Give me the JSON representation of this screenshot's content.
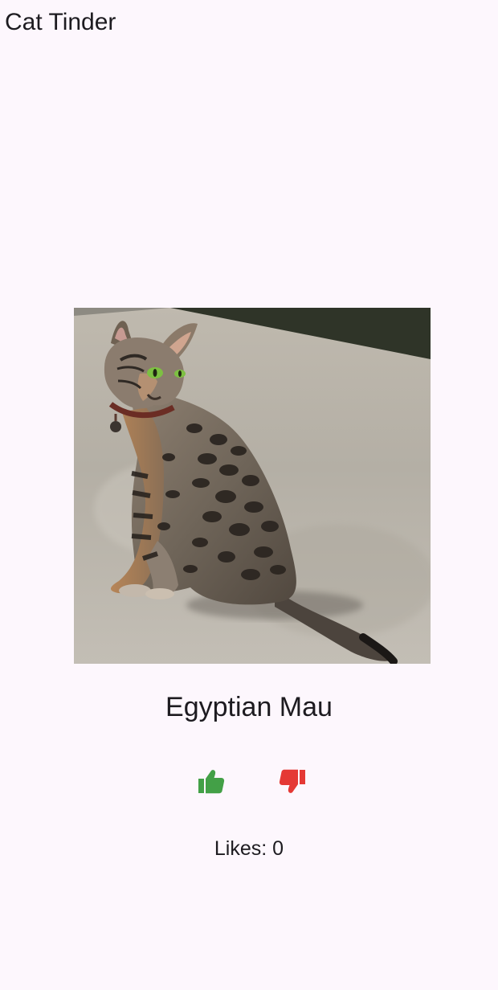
{
  "app": {
    "title": "Cat Tinder"
  },
  "cat": {
    "breed": "Egyptian Mau"
  },
  "actions": {
    "like_icon": "thumb-up-icon",
    "dislike_icon": "thumb-down-icon",
    "like_color": "#43a047",
    "dislike_color": "#e53935"
  },
  "stats": {
    "likes_label": "Likes:",
    "likes_count": "0"
  },
  "theme": {
    "background": "#fdf7fd",
    "text": "#1d1b20"
  }
}
